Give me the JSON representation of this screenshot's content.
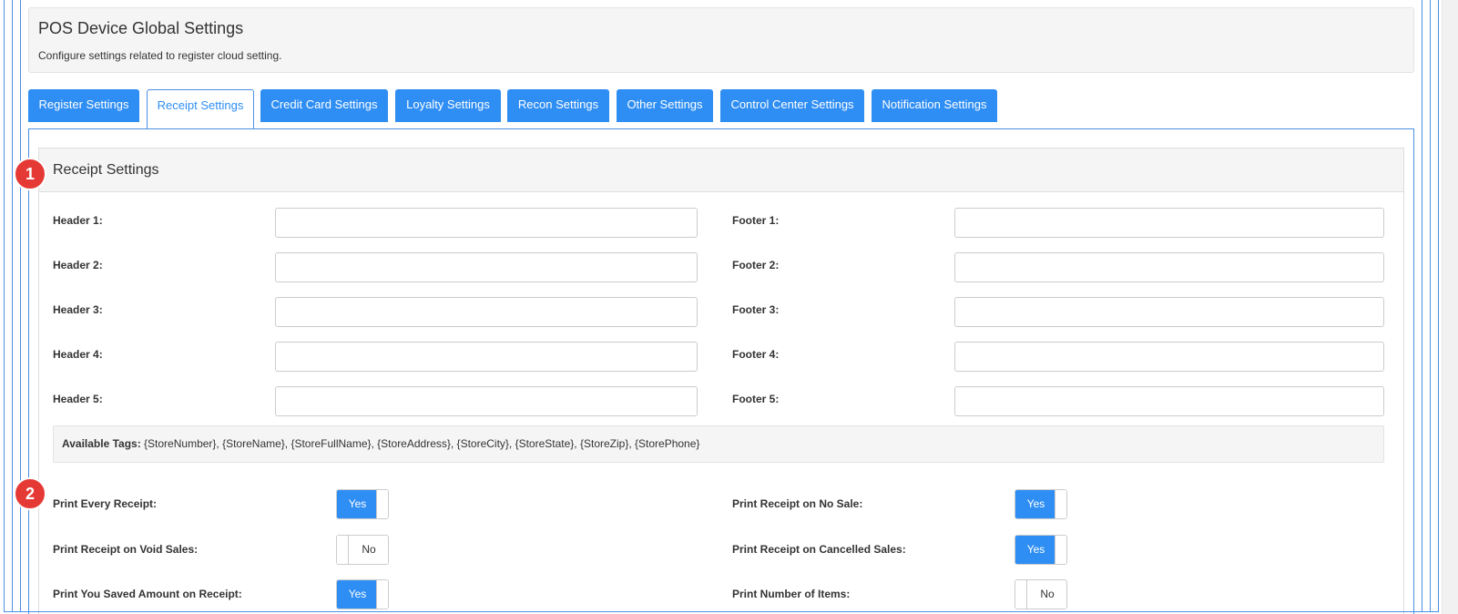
{
  "header": {
    "title": "POS Device Global Settings",
    "subtitle": "Configure settings related to register cloud setting."
  },
  "tabs": [
    {
      "label": "Register Settings",
      "active": false
    },
    {
      "label": "Receipt Settings",
      "active": true
    },
    {
      "label": "Credit Card Settings",
      "active": false
    },
    {
      "label": "Loyalty Settings",
      "active": false
    },
    {
      "label": "Recon Settings",
      "active": false
    },
    {
      "label": "Other Settings",
      "active": false
    },
    {
      "label": "Control Center Settings",
      "active": false
    },
    {
      "label": "Notification Settings",
      "active": false
    }
  ],
  "panel": {
    "title": "Receipt Settings"
  },
  "fields": {
    "header1": {
      "label": "Header 1:",
      "value": ""
    },
    "header2": {
      "label": "Header 2:",
      "value": ""
    },
    "header3": {
      "label": "Header 3:",
      "value": ""
    },
    "header4": {
      "label": "Header 4:",
      "value": ""
    },
    "header5": {
      "label": "Header 5:",
      "value": ""
    },
    "footer1": {
      "label": "Footer 1:",
      "value": ""
    },
    "footer2": {
      "label": "Footer 2:",
      "value": ""
    },
    "footer3": {
      "label": "Footer 3:",
      "value": ""
    },
    "footer4": {
      "label": "Footer 4:",
      "value": ""
    },
    "footer5": {
      "label": "Footer 5:",
      "value": ""
    }
  },
  "tags": {
    "label": "Available Tags:",
    "text": " {StoreNumber}, {StoreName}, {StoreFullName}, {StoreAddress}, {StoreCity}, {StoreState}, {StoreZip}, {StorePhone}"
  },
  "toggles": {
    "print_every_receipt": {
      "label": "Print Every Receipt:",
      "state": "Yes"
    },
    "print_no_sale": {
      "label": "Print Receipt on No Sale:",
      "state": "Yes"
    },
    "print_void_sales": {
      "label": "Print Receipt on Void Sales:",
      "state": "No"
    },
    "print_cancelled_sales": {
      "label": "Print Receipt on Cancelled Sales:",
      "state": "Yes"
    },
    "print_saved_amount": {
      "label": "Print You Saved Amount on Receipt:",
      "state": "Yes"
    },
    "print_number_items": {
      "label": "Print Number of Items:",
      "state": "No"
    }
  },
  "badges": {
    "one": "1",
    "two": "2"
  },
  "colors": {
    "accent": "#2f8ef3",
    "badge": "#e53935",
    "border": "#4a90e2"
  }
}
